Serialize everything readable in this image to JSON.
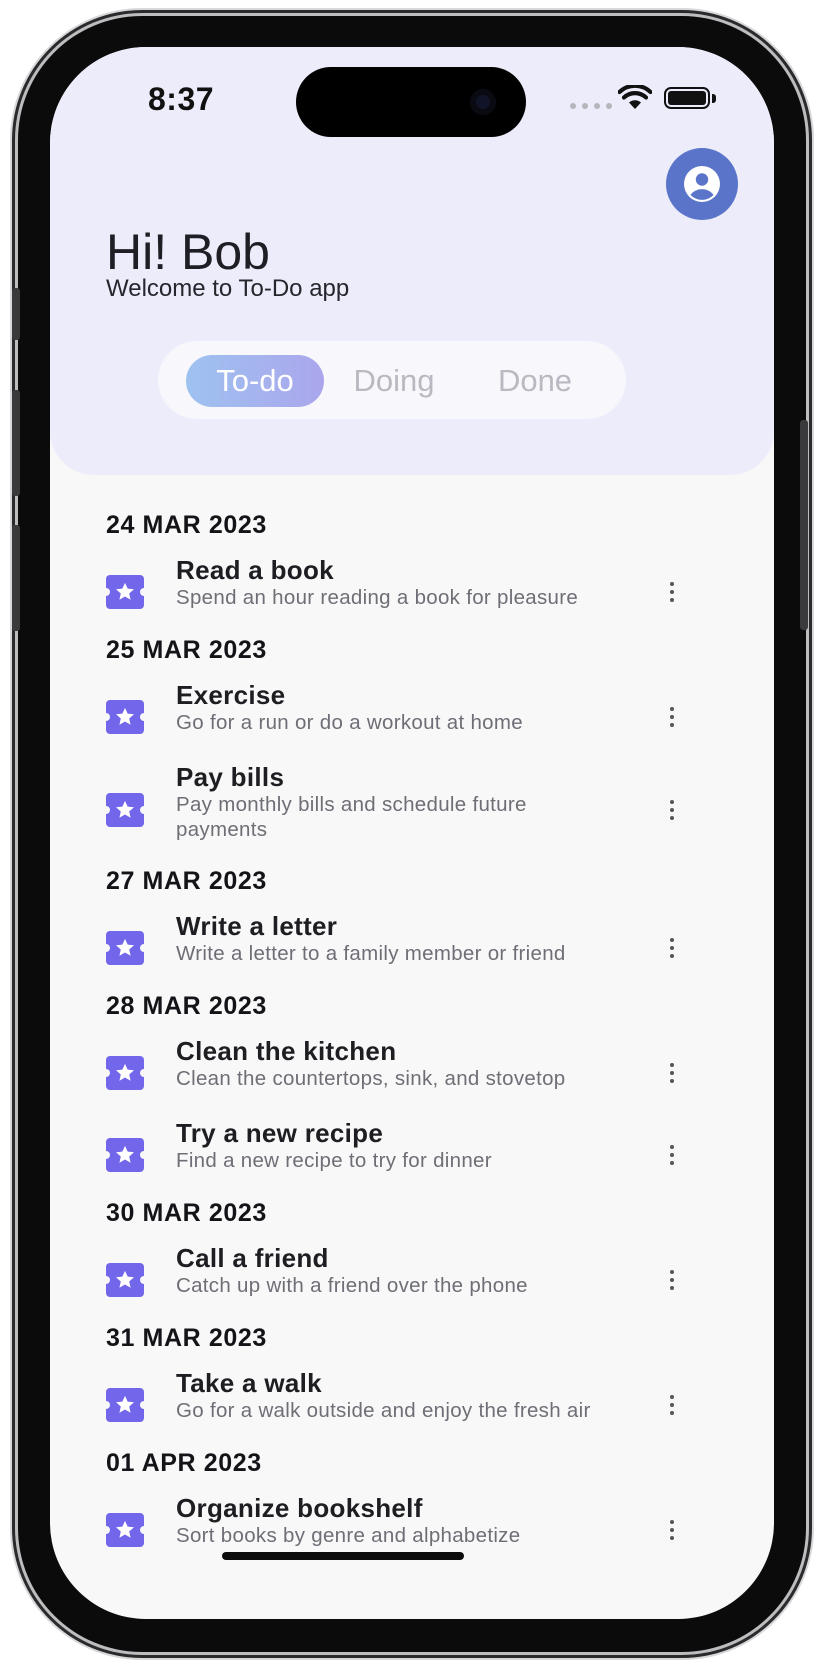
{
  "status_bar": {
    "time": "8:37",
    "icons": [
      "signal-dots-icon",
      "wifi-icon",
      "battery-icon"
    ]
  },
  "header": {
    "greeting": "Hi! Bob",
    "welcome": "Welcome to To-Do app",
    "avatar_icon": "user-circle-icon"
  },
  "tabs": [
    {
      "label": "To-do",
      "active": true
    },
    {
      "label": "Doing",
      "active": false
    },
    {
      "label": "Done",
      "active": false
    }
  ],
  "groups": [
    {
      "date": "24 MAR 2023",
      "tasks": [
        {
          "title": "Read a book",
          "description": "Spend an hour reading a book for pleasure"
        }
      ]
    },
    {
      "date": "25 MAR 2023",
      "tasks": [
        {
          "title": "Exercise",
          "description": "Go for a run or do a workout at home"
        },
        {
          "title": "Pay bills",
          "description": "Pay monthly bills and schedule future payments"
        }
      ]
    },
    {
      "date": "27 MAR 2023",
      "tasks": [
        {
          "title": "Write a letter",
          "description": "Write a letter to a family member or friend"
        }
      ]
    },
    {
      "date": "28 MAR 2023",
      "tasks": [
        {
          "title": "Clean the kitchen",
          "description": "Clean the countertops, sink, and stovetop"
        },
        {
          "title": "Try a new recipe",
          "description": "Find a new recipe to try for dinner"
        }
      ]
    },
    {
      "date": "30 MAR 2023",
      "tasks": [
        {
          "title": "Call a friend",
          "description": "Catch up with a friend over the phone"
        }
      ]
    },
    {
      "date": "31 MAR 2023",
      "tasks": [
        {
          "title": "Take a walk",
          "description": "Go for a walk outside and enjoy the fresh air"
        }
      ]
    },
    {
      "date": "01 APR 2023",
      "tasks": [
        {
          "title": "Organize bookshelf",
          "description": "Sort books by genre and alphabetize"
        }
      ]
    }
  ],
  "colors": {
    "accent": "#7266ea",
    "avatar": "#5a74c9",
    "header_bg": "#ececfb",
    "tab_active_start": "#9ec2f0",
    "tab_active_end": "#aba6ec"
  }
}
